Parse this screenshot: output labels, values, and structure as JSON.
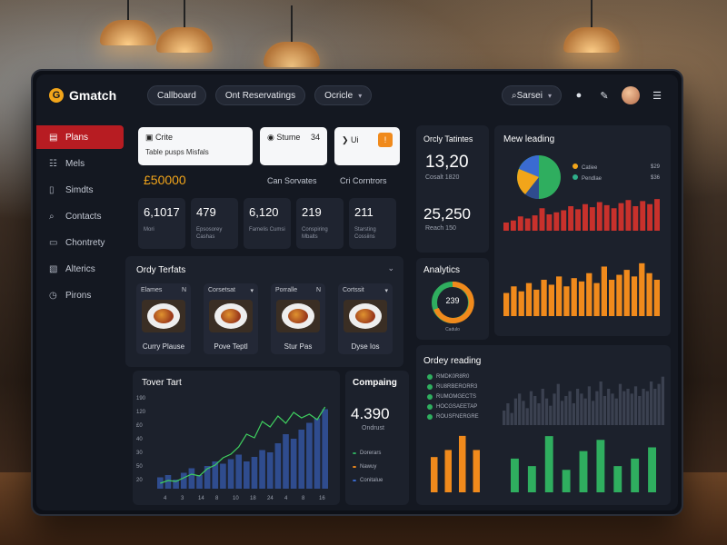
{
  "app": {
    "logo_letter": "G",
    "name": "Gmatch"
  },
  "topbar": {
    "tab1": "Callboard",
    "tab2": "Ont Reservatings",
    "tab3": "Ocricle",
    "search": "Sarsei",
    "icons": [
      "search-icon",
      "user-icon",
      "edit-icon",
      "avatar",
      "menu-icon"
    ]
  },
  "sidebar": {
    "items": [
      {
        "label": "Plans",
        "icon": "▤"
      },
      {
        "label": "Mels",
        "icon": "☷"
      },
      {
        "label": "Simdts",
        "icon": "▯"
      },
      {
        "label": "Contacts",
        "icon": "⌕"
      },
      {
        "label": "Chontrety",
        "icon": "▭"
      },
      {
        "label": "Alterics",
        "icon": "▧"
      },
      {
        "label": "Pirons",
        "icon": "◷"
      }
    ]
  },
  "wcards": [
    {
      "title": "Crite",
      "sub": "Table pusps Misfals"
    },
    {
      "title": "Stume",
      "tag": "34"
    },
    {
      "title": "Ui",
      "tag": "!"
    }
  ],
  "kpi": {
    "value": "£50000",
    "c2": "Can Sorvates",
    "c3": "Cri Corntrors"
  },
  "stats": [
    {
      "value": "6,1017",
      "label": "Mori"
    },
    {
      "value": "479",
      "label": "Epsosorey Cashas"
    },
    {
      "value": "6,120",
      "label": "Famelis Cumsi"
    },
    {
      "value": "219",
      "label": "Conspiring Mbalts"
    },
    {
      "value": "211",
      "label": "Starsting Cossiins"
    }
  ],
  "orders_panel": {
    "title": "Orcly Tatintes",
    "v1": "13,20",
    "s1": "Cosalt 1820",
    "v2": "25,250",
    "s2": "Reach 150"
  },
  "mew": {
    "title": "Mew leading",
    "legend": [
      {
        "label": "Catiee",
        "color": "#f2a51a",
        "val": "$29"
      },
      {
        "label": "Pendlae",
        "color": "#2fae8a",
        "val": "$36"
      }
    ],
    "bars": [
      8,
      10,
      14,
      12,
      15,
      22,
      16,
      18,
      20,
      24,
      21,
      26,
      23,
      28,
      25,
      22,
      27,
      30,
      24,
      29,
      26,
      31
    ],
    "colors": {
      "red": "#c8312c",
      "orange": "#f08a1c",
      "green": "#2fae5f",
      "blue": "#2f4c8e",
      "gray": "#3a3f4d"
    }
  },
  "orange_bars": [
    14,
    18,
    15,
    20,
    16,
    22,
    19,
    24,
    18,
    23,
    21,
    26,
    20,
    30,
    22,
    25,
    28,
    24,
    32,
    26,
    22
  ],
  "order_tabs": {
    "title": "Ordy Terfats",
    "items": [
      {
        "head": "Elames",
        "tag": "N",
        "name": "Curry Plause"
      },
      {
        "head": "Corsetsat",
        "tag": "▾",
        "name": "Pove Teptl"
      },
      {
        "head": "Porralle",
        "tag": "N",
        "name": "Stur Pas"
      },
      {
        "head": "Cortssit",
        "tag": "▾",
        "name": "Dyse Ios"
      }
    ]
  },
  "analytics": {
    "title": "Analytics",
    "center": "239",
    "sub": "Cadulo"
  },
  "trend": {
    "title": "Tover Tart",
    "yticks": [
      "190",
      "120",
      "£0",
      "40",
      "30",
      "50",
      "20"
    ],
    "xticks": [
      "4",
      "3",
      "14",
      "8",
      "10",
      "18",
      "24",
      "4",
      "8",
      "16"
    ],
    "bars": [
      10,
      12,
      8,
      14,
      18,
      12,
      20,
      24,
      22,
      26,
      30,
      24,
      28,
      34,
      32,
      40,
      48,
      44,
      52,
      58,
      62,
      70
    ],
    "line": [
      6,
      9,
      8,
      12,
      16,
      14,
      22,
      26,
      34,
      38,
      46,
      60,
      56,
      74,
      68,
      80,
      72,
      84,
      78,
      82,
      76,
      90
    ]
  },
  "compaing": {
    "title": "Compaing",
    "value": "4.390",
    "sub": "Ondrust",
    "legend": [
      {
        "label": "Dorerars",
        "color": "#2fae5f"
      },
      {
        "label": "Nawuy",
        "color": "#f08a1c"
      },
      {
        "label": "Conitalue",
        "color": "#3a6bd1"
      }
    ]
  },
  "ordy_leading": {
    "title": "Ordey reading",
    "legend": [
      "RMDK0R8R0",
      "RU8RBERORR3",
      "RUMOMGECTS",
      "HOCGSAEETAP",
      "ROUSFNERGRE"
    ],
    "gray_bars": [
      12,
      18,
      10,
      22,
      26,
      20,
      14,
      28,
      24,
      18,
      30,
      22,
      16,
      26,
      34,
      20,
      24,
      28,
      18,
      30,
      26,
      22,
      32,
      20,
      28,
      36,
      24,
      30,
      26,
      22,
      34,
      28,
      30,
      26,
      32,
      24,
      30,
      28,
      36,
      30,
      34,
      40
    ],
    "orange": [
      20,
      24,
      32,
      24
    ],
    "green": [
      18,
      14,
      30,
      12,
      22,
      28,
      14,
      18,
      24
    ]
  }
}
